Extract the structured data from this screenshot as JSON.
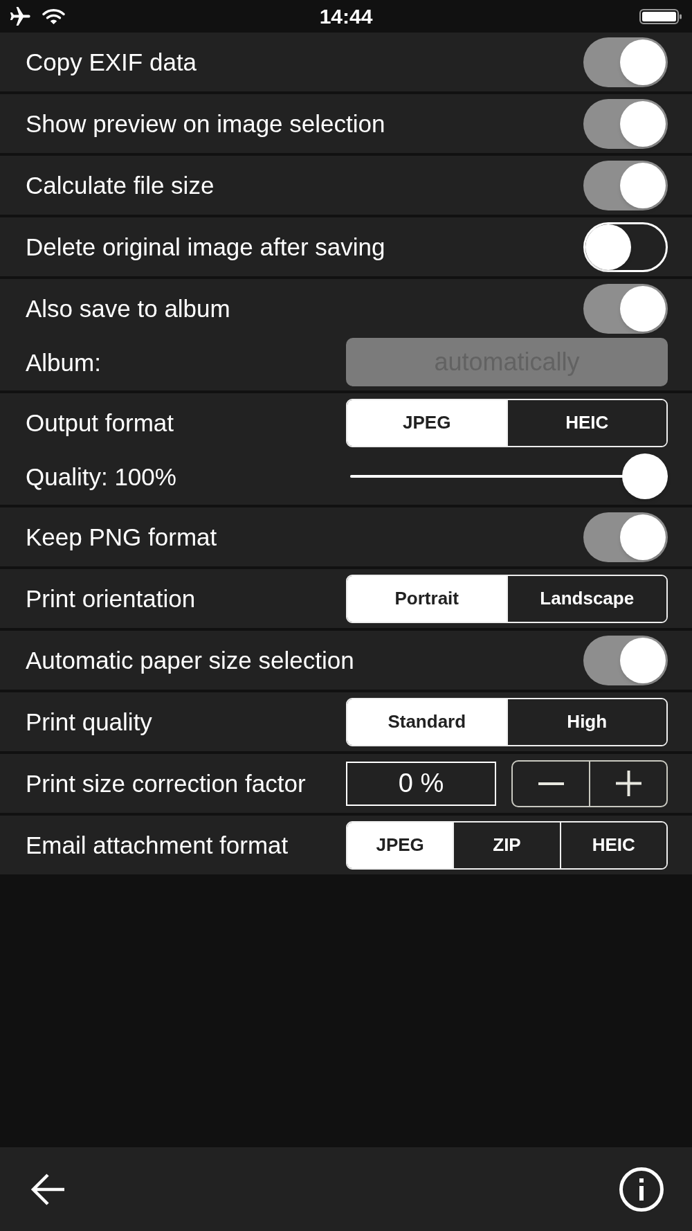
{
  "status_bar": {
    "time": "14:44"
  },
  "sections": [
    {
      "items": [
        {
          "kind": "toggle",
          "label": "Copy EXIF data",
          "on": true
        }
      ]
    },
    {
      "items": [
        {
          "kind": "toggle",
          "label": "Show preview on image selection",
          "on": true
        }
      ]
    },
    {
      "items": [
        {
          "kind": "toggle",
          "label": "Calculate file size",
          "on": true
        }
      ]
    },
    {
      "items": [
        {
          "kind": "toggle",
          "label": "Delete original image after saving",
          "on": false
        }
      ]
    },
    {
      "items": [
        {
          "kind": "toggle",
          "label": "Also save to album",
          "on": true
        },
        {
          "kind": "field",
          "label": "Album:",
          "value": "automatically",
          "disabled": true
        }
      ]
    },
    {
      "items": [
        {
          "kind": "segmented",
          "label": "Output format",
          "options": [
            {
              "label": "JPEG",
              "selected": true
            },
            {
              "label": "HEIC",
              "selected": false
            }
          ]
        },
        {
          "kind": "slider",
          "label": "Quality: 100%",
          "level": 1
        }
      ]
    },
    {
      "items": [
        {
          "kind": "toggle",
          "label": "Keep PNG format",
          "on": true
        }
      ]
    },
    {
      "items": [
        {
          "kind": "segmented",
          "label": "Print orientation",
          "options": [
            {
              "label": "Portrait",
              "selected": true
            },
            {
              "label": "Landscape",
              "selected": false
            }
          ]
        }
      ]
    },
    {
      "items": [
        {
          "kind": "toggle",
          "label": "Automatic paper size selection",
          "on": true
        }
      ]
    },
    {
      "items": [
        {
          "kind": "segmented",
          "label": "Print quality",
          "options": [
            {
              "label": "Standard",
              "selected": true
            },
            {
              "label": "High",
              "selected": false
            }
          ]
        }
      ]
    },
    {
      "items": [
        {
          "kind": "stepper",
          "label": "Print size correction factor",
          "value": "0 %"
        }
      ]
    },
    {
      "items": [
        {
          "kind": "segmented",
          "label": "Email attachment format",
          "options": [
            {
              "label": "JPEG",
              "selected": true
            },
            {
              "label": "ZIP",
              "selected": false
            },
            {
              "label": "HEIC",
              "selected": false
            }
          ]
        }
      ]
    }
  ]
}
